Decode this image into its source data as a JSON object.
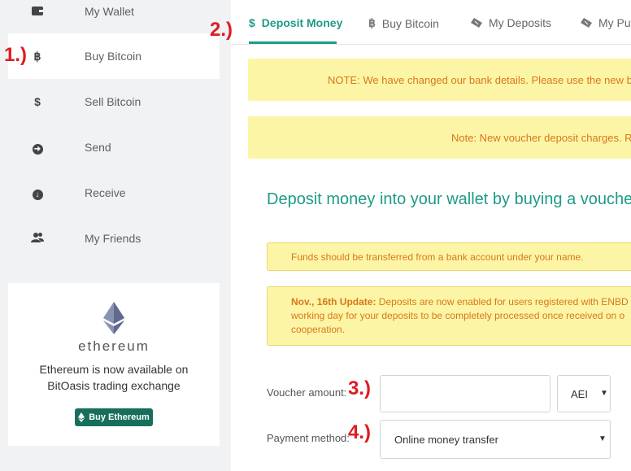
{
  "sidebar": {
    "items": [
      {
        "label": "My Wallet",
        "icon": "wallet-icon"
      },
      {
        "label": "Buy Bitcoin",
        "icon": "bitcoin-icon"
      },
      {
        "label": "Sell Bitcoin",
        "icon": "dollar-icon"
      },
      {
        "label": "Send",
        "icon": "arrow-right-circle-icon"
      },
      {
        "label": "Receive",
        "icon": "arrow-down-circle-icon"
      },
      {
        "label": "My Friends",
        "icon": "users-icon"
      }
    ]
  },
  "annotations": {
    "one": "1.)",
    "two": "2.)",
    "three": "3.)",
    "four": "4.)"
  },
  "ethereum_card": {
    "wordmark": "ethereum",
    "text_line1": "Ethereum is now available on",
    "text_line2": "BitOasis trading exchange",
    "button_label": "Buy Ethereum"
  },
  "tabs": [
    {
      "label": "Deposit Money",
      "icon": "dollar-icon",
      "active": true
    },
    {
      "label": "Buy Bitcoin",
      "icon": "bitcoin-icon"
    },
    {
      "label": "My Deposits",
      "icon": "ticket-icon"
    },
    {
      "label": "My Pu",
      "icon": "ticket-icon"
    }
  ],
  "notices": {
    "bank": "NOTE: We have changed our bank details. Please use the new bank",
    "voucher": "Note: New voucher deposit charges. Rea"
  },
  "main": {
    "heading": "Deposit money into your wallet by buying a voucher",
    "warn_funds": "Funds should be transferred from a bank account under your name.",
    "update_title": "Nov., 16th Update:",
    "update_line1": " Deposits are now enabled for users registered with ENBD",
    "update_line2": "working day for your deposits to be completely processed once received on o",
    "update_line3": "cooperation."
  },
  "form": {
    "voucher_label": "Voucher amount:",
    "voucher_value": "",
    "currency_value": "AEI",
    "payment_label": "Payment method:",
    "payment_value": "Online money transfer"
  },
  "colors": {
    "accent": "#1d9b85",
    "notice_bg": "#fdf5a6",
    "notice_text": "#d9771b",
    "annotation": "#e01b22",
    "button_bg": "#176f5b"
  }
}
